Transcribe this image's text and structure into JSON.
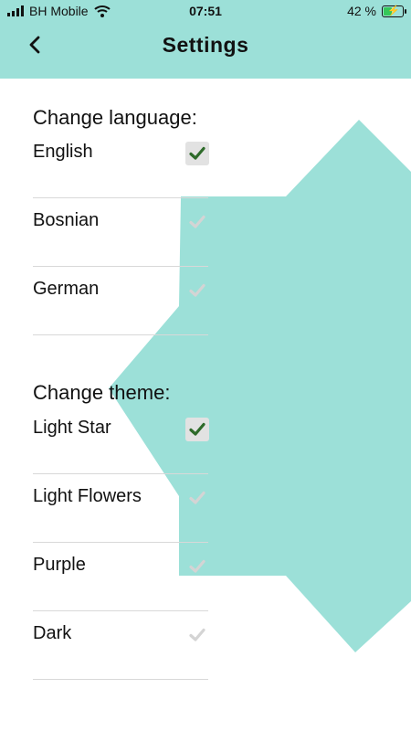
{
  "status": {
    "carrier": "BH Mobile",
    "time": "07:51",
    "battery": "42 %",
    "battery_level": 0.42,
    "charging": true
  },
  "header": {
    "title": "Settings",
    "back_icon": "chevron-left-icon"
  },
  "colors": {
    "accent": "#9ce0d8",
    "check_on": "#2e6b2a",
    "check_off": "#d4d4d4"
  },
  "language": {
    "title": "Change language:",
    "options": [
      {
        "label": "English",
        "selected": true
      },
      {
        "label": "Bosnian",
        "selected": false
      },
      {
        "label": "German",
        "selected": false
      }
    ]
  },
  "theme": {
    "title": "Change theme:",
    "options": [
      {
        "label": "Light Star",
        "selected": true
      },
      {
        "label": "Light Flowers",
        "selected": false
      },
      {
        "label": "Purple",
        "selected": false
      },
      {
        "label": "Dark",
        "selected": false
      }
    ]
  }
}
